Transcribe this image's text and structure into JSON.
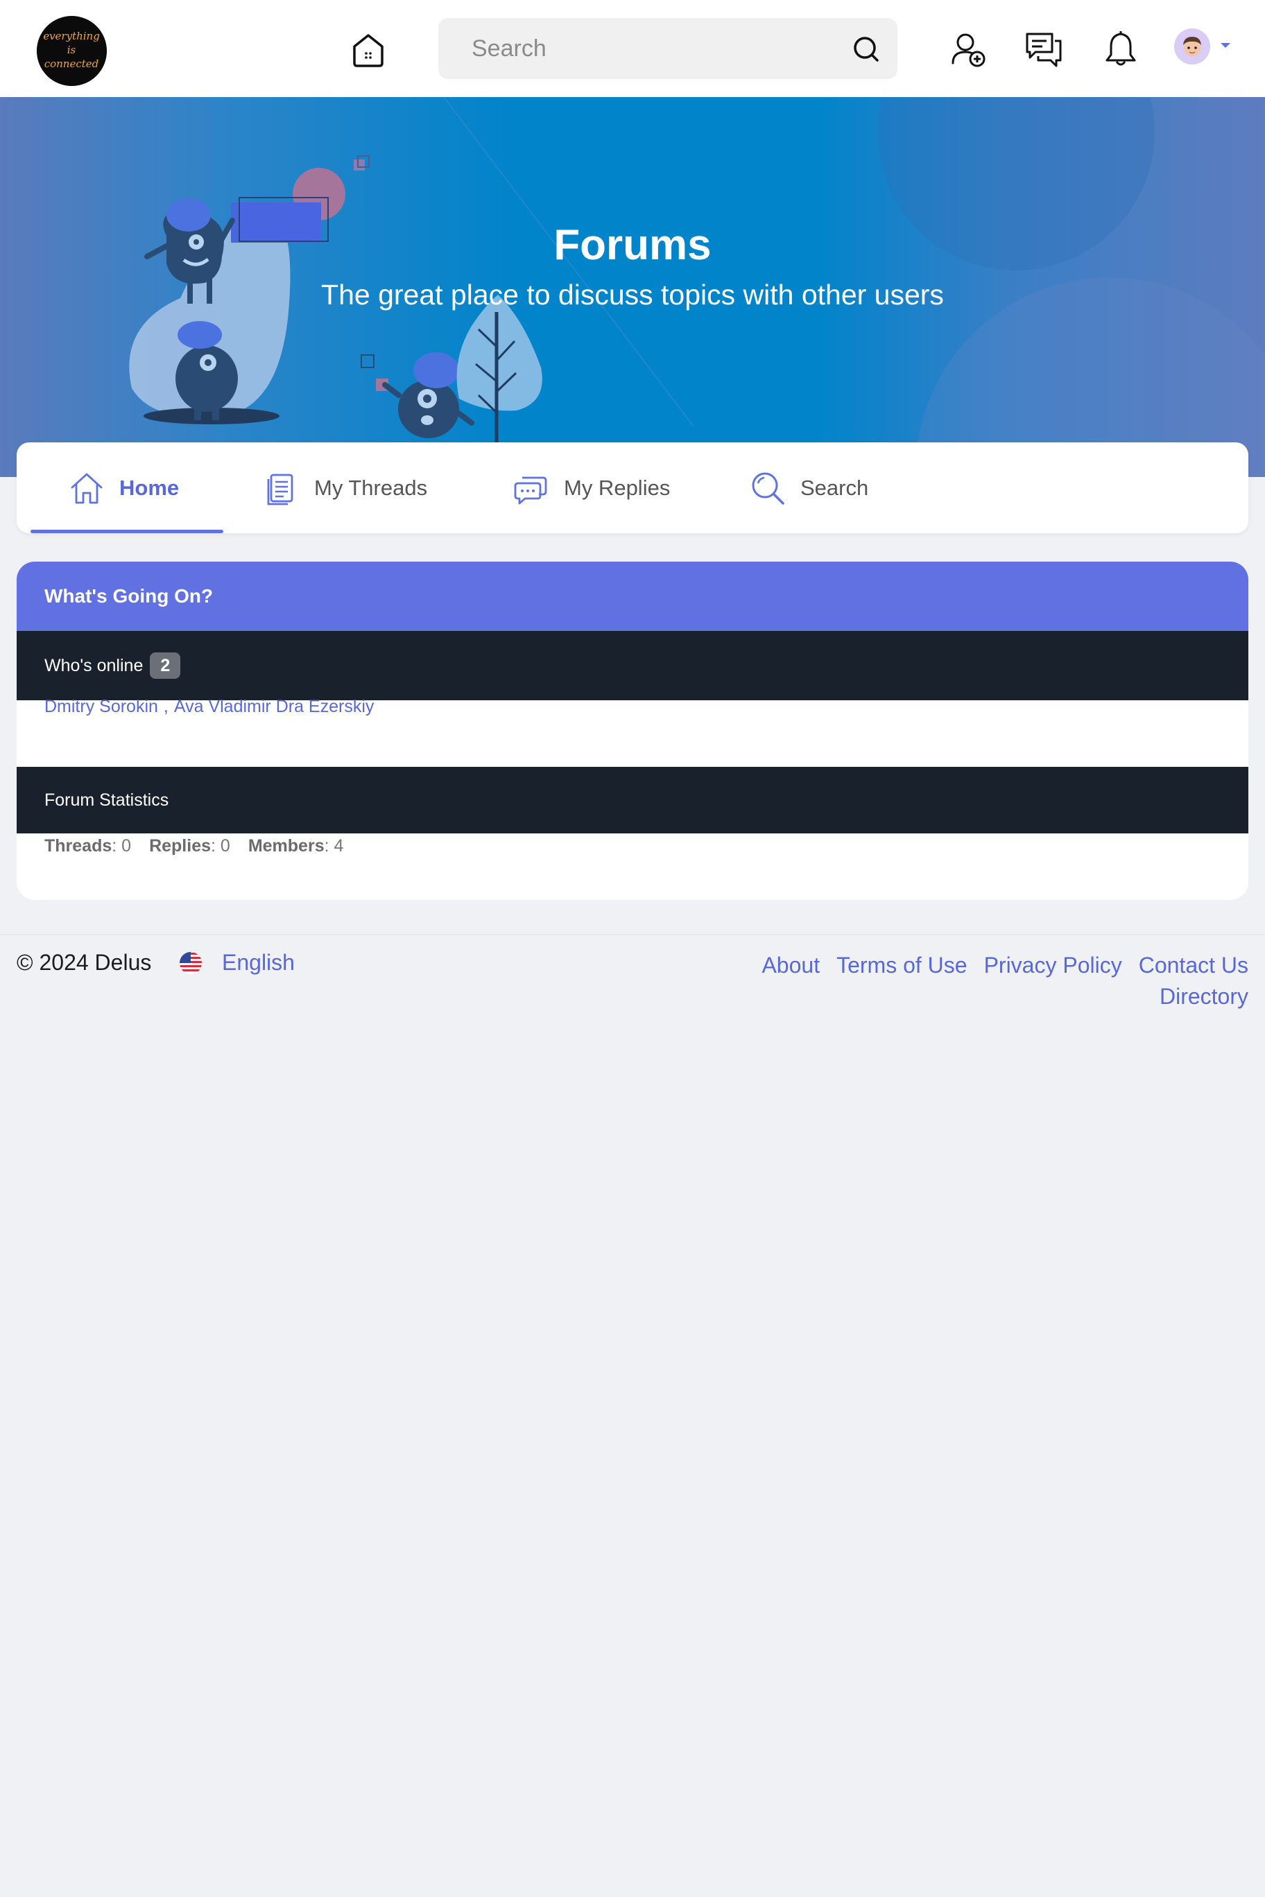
{
  "header": {
    "logo_lines": [
      "everything",
      "is",
      "connected"
    ],
    "search_placeholder": "Search",
    "icons": [
      "home-icon",
      "search-icon",
      "add-user-icon",
      "messages-icon",
      "bell-icon",
      "avatar",
      "chevron-down-icon"
    ]
  },
  "hero": {
    "title": "Forums",
    "subtitle": "The great place to discuss topics with other users"
  },
  "tabs": [
    {
      "label": "Home",
      "icon": "home-icon",
      "active": true
    },
    {
      "label": "My Threads",
      "icon": "document-icon",
      "active": false
    },
    {
      "label": "My Replies",
      "icon": "chat-bubble-icon",
      "active": false
    },
    {
      "label": "Search",
      "icon": "search-icon",
      "active": false
    }
  ],
  "whats_going_on": {
    "title": "What's Going On?",
    "online_label": "Who's online",
    "online_count": "2",
    "online_users": [
      "Dmitry Sorokin",
      "Ava Vladimir Dra Ezerskiy"
    ],
    "online_separator": ",",
    "stats_title": "Forum Statistics",
    "stats": [
      {
        "label": "Threads",
        "value": "0"
      },
      {
        "label": "Replies",
        "value": "0"
      },
      {
        "label": "Members",
        "value": "4"
      }
    ]
  },
  "footer": {
    "copyright": "© 2024 Delus",
    "language": "English",
    "links": [
      "About",
      "Terms of Use",
      "Privacy Policy",
      "Contact Us",
      "Directory"
    ]
  },
  "colors": {
    "accent": "#5e72e4",
    "hero_blue": "#0284cb",
    "dark_row": "#19222c",
    "card_header": "#6271e2"
  }
}
